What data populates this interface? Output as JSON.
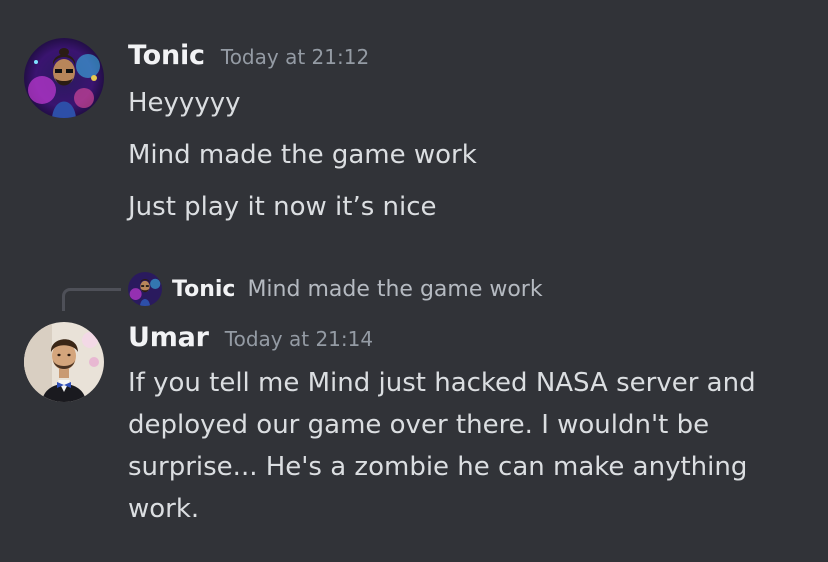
{
  "messages": [
    {
      "author": "Tonic",
      "timestamp": "Today at 21:12",
      "avatar_icon": "user-avatar-tonic-icon",
      "lines": [
        "Heyyyyy",
        "Mind made the game work",
        "Just play it now it’s nice"
      ]
    },
    {
      "author": "Umar",
      "timestamp": "Today at 21:14",
      "avatar_icon": "user-avatar-umar-icon",
      "reply": {
        "author": "Tonic",
        "text": "Mind made the game work"
      },
      "text": "If you tell me Mind just hacked NASA server and deployed our game over there. I wouldn't be surprise... He's a zombie he can make anything work."
    }
  ],
  "colors": {
    "background": "#313338",
    "username": "#f2f3f5",
    "timestamp": "#949ba4",
    "text": "#dbdee1",
    "reply_line": "#4e5058"
  }
}
